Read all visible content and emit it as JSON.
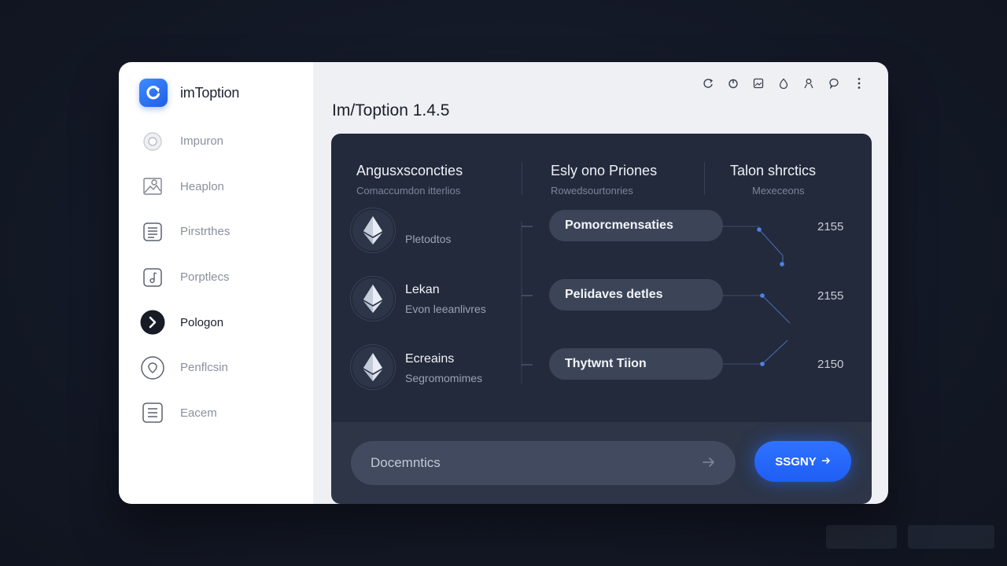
{
  "brand": {
    "name": "imToption",
    "icon": "refresh-logo-icon",
    "color": "#2b74f5"
  },
  "sidebar": {
    "items": [
      {
        "label": "Impuron",
        "icon": "circle-toggle-icon"
      },
      {
        "label": "Heaplon",
        "icon": "image-search-icon"
      },
      {
        "label": "Pirstrthes",
        "icon": "list-box-icon"
      },
      {
        "label": "Porptlecs",
        "icon": "music-note-icon"
      },
      {
        "label": "Pologon",
        "icon": "play-circle-icon",
        "active": true
      },
      {
        "label": "Penflcsin",
        "icon": "shield-circle-icon"
      },
      {
        "label": "Eacem",
        "icon": "document-lines-icon"
      }
    ]
  },
  "toolbar": {
    "icons": [
      "refresh-icon",
      "power-icon",
      "image-icon",
      "drop-icon",
      "person-icon",
      "chat-icon",
      "more-vertical-icon"
    ]
  },
  "page": {
    "title": "Im/Toption 1.4.5"
  },
  "columns": [
    {
      "title": "Angusxsconcties",
      "subtitle": "Comaccumdon itterlios"
    },
    {
      "title": "Esly ono Priones",
      "subtitle": "Rowedsourtonries"
    },
    {
      "title": "Talon shrctics",
      "subtitle": "Mexeceons"
    }
  ],
  "rows": [
    {
      "title": "",
      "subtitle": "Pletodtos",
      "pill": "Pomorcmensaties",
      "value": "2155",
      "icon": "ethereum-icon"
    },
    {
      "title": "Lekan",
      "subtitle": "Evon leeanlivres",
      "pill": "Pelidaves detles",
      "value": "2155",
      "icon": "ethereum-icon"
    },
    {
      "title": "Ecreains",
      "subtitle": "Segromomimes",
      "pill": "Thytwnt Tiion",
      "value": "2150",
      "icon": "ethereum-icon"
    }
  ],
  "search": {
    "value": "Docemntics",
    "icon": "arrow-right-icon"
  },
  "cta": {
    "label": "SSGNY",
    "icon": "arrow-right-icon",
    "color": "#2267ff"
  },
  "colors": {
    "panel": "#232a3b",
    "accent": "#2f72ff",
    "sidebar": "#ffffff"
  }
}
